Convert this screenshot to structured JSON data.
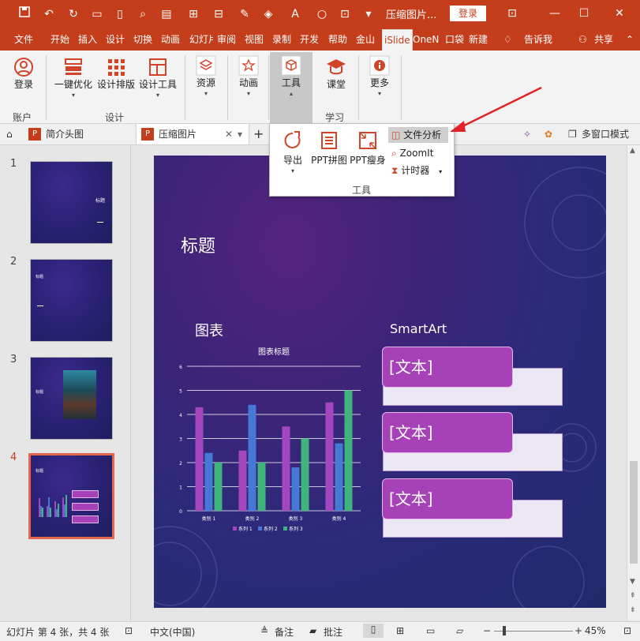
{
  "window": {
    "doc_title": "压缩图片...",
    "login_label": "登录"
  },
  "menu_tabs": [
    "文件",
    "开始",
    "插入",
    "设计",
    "切换",
    "动画",
    "幻灯片",
    "审阅",
    "视图",
    "录制",
    "开发",
    "帮助",
    "金山",
    "iSlide",
    "OneN",
    "口袋",
    "新建",
    "告诉我",
    "共享"
  ],
  "ribbon": {
    "account": {
      "label": "登录",
      "group": "账户"
    },
    "design": {
      "optimize": "一键优化",
      "layout": "设计排版",
      "tools": "设计工具",
      "group": "设计"
    },
    "resources": {
      "label": "资源"
    },
    "animation": {
      "label": "动画"
    },
    "tools": {
      "label": "工具"
    },
    "classroom": {
      "label": "课堂",
      "group": "学习"
    },
    "more": {
      "label": "更多"
    }
  },
  "doc_tabs": {
    "tab1": "简介头图",
    "tab2": "压缩图片",
    "multi_window": "多窗口模式"
  },
  "popup": {
    "export": "导出",
    "puzzle": "PPT拼图",
    "slim": "PPT瘦身",
    "file_analysis": "文件分析",
    "zoomit": "ZoomIt",
    "timer": "计时器",
    "group": "工具"
  },
  "thumbnails": [
    {
      "num": "1",
      "title": "标题"
    },
    {
      "num": "2",
      "title": "标题"
    },
    {
      "num": "3",
      "title": "标题"
    },
    {
      "num": "4",
      "title": "标题"
    }
  ],
  "slide": {
    "title": "标题",
    "chart_heading": "图表",
    "smartart_heading": "SmartArt",
    "smart_items": [
      "[文本]",
      "[文本]",
      "[文本]"
    ]
  },
  "chart_data": {
    "type": "bar",
    "title": "图表标题",
    "categories": [
      "类别 1",
      "类别 2",
      "类别 3",
      "类别 4"
    ],
    "series": [
      {
        "name": "系列 1",
        "values": [
          4.3,
          2.5,
          3.5,
          4.5
        ],
        "color": "#a347c0"
      },
      {
        "name": "系列 2",
        "values": [
          2.4,
          4.4,
          1.8,
          2.8
        ],
        "color": "#4678d6"
      },
      {
        "name": "系列 3",
        "values": [
          2.0,
          2.0,
          3.0,
          5.0
        ],
        "color": "#3fb47d"
      }
    ],
    "ylim": [
      0,
      6
    ],
    "yticks": [
      "0",
      "1",
      "2",
      "3",
      "4",
      "5",
      "6"
    ],
    "grid": true,
    "legend": "bottom"
  },
  "status": {
    "slide_info": "幻灯片 第 4 张，共 4 张",
    "language": "中文(中国)",
    "notes": "备注",
    "comments": "批注",
    "zoom": "45%"
  },
  "colors": {
    "brand": "#c43e1c",
    "accent_purple": "#a741b7"
  }
}
